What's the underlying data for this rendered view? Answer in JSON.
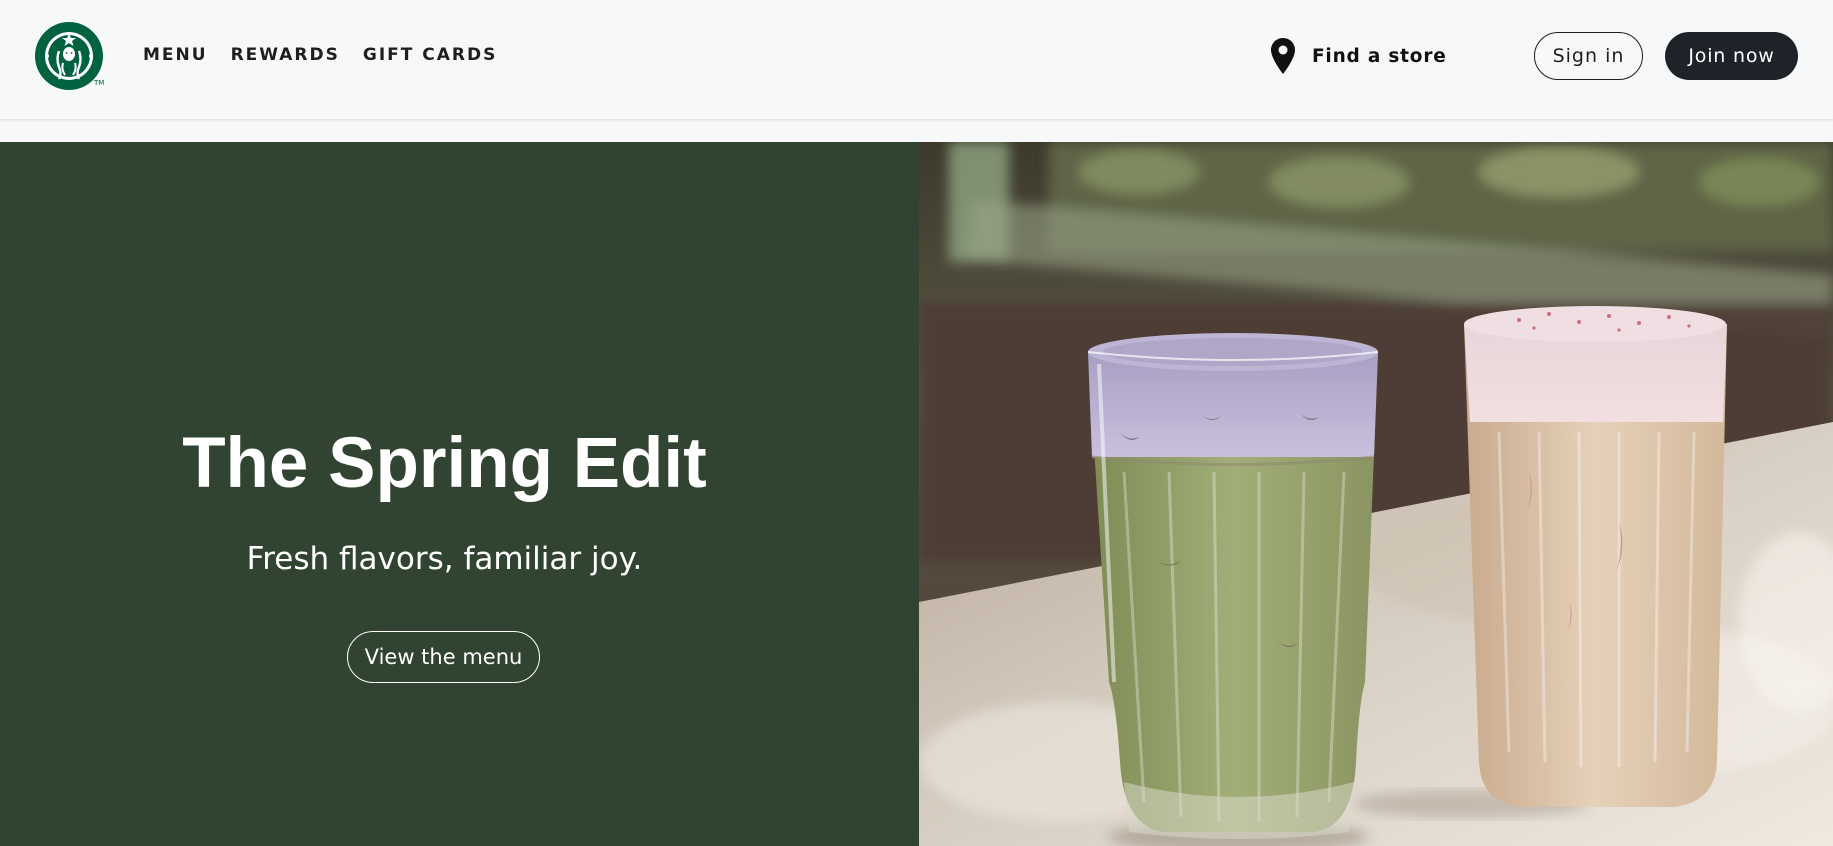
{
  "brand": {
    "logo_icon": "siren-logo-icon",
    "trademark": "TM",
    "color": "#006241"
  },
  "nav": {
    "items": [
      {
        "label": "MENU"
      },
      {
        "label": "REWARDS"
      },
      {
        "label": "GIFT CARDS"
      }
    ]
  },
  "header": {
    "find_store": {
      "icon": "location-pin-icon",
      "label": "Find a store"
    },
    "sign_in_label": "Sign in",
    "join_now_label": "Join now"
  },
  "hero": {
    "title": "The Spring Edit",
    "subtitle": "Fresh flavors, familiar joy.",
    "cta_label": "View the menu",
    "background_color": "#314431",
    "image": {
      "subject": "drinks-photo",
      "items": [
        "iced-matcha-lavender-drink",
        "iced-pink-latte-drink"
      ]
    }
  },
  "colors": {
    "header_bg": "#f7f8fa",
    "dark_button": "#1e2329",
    "text_dark": "#1e1e1e"
  }
}
